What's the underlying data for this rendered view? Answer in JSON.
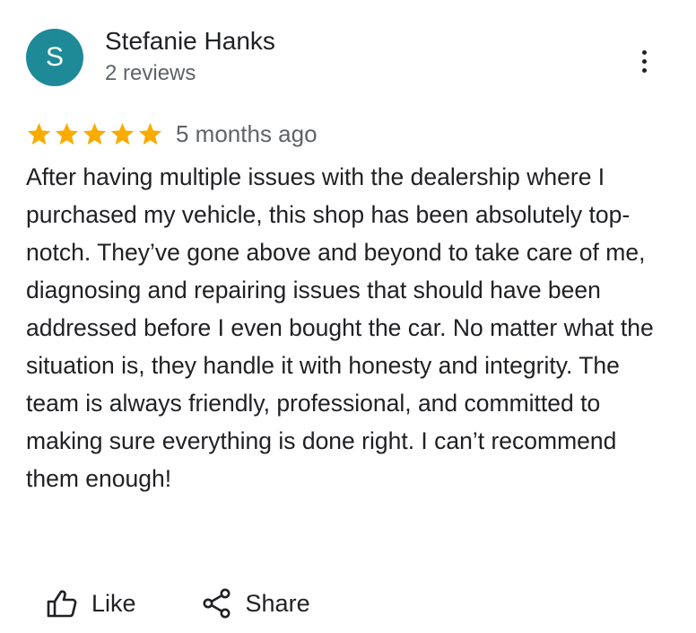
{
  "reviewer": {
    "avatar_initial": "S",
    "avatar_color": "#1e8a98",
    "name": "Stefanie Hanks",
    "review_count": "2 reviews"
  },
  "more_menu": {
    "icon": "more-vert-icon"
  },
  "review": {
    "rating": 5,
    "max_rating": 5,
    "star_color": "#f9ab00",
    "date": "5 months ago",
    "text": "After having multiple issues with the dealership where I purchased my vehicle, this shop has been absolutely top-notch. They’ve gone above and beyond to take care of me, diagnosing and repairing issues that should have been addressed before I even bought the car. No matter what the situation is, they handle it with honesty and integrity. The team is always friendly, professional, and committed to making sure everything is done right. I can’t recommend them enough!"
  },
  "actions": {
    "like_label": "Like",
    "like_icon": "thumb-up-icon",
    "share_label": "Share",
    "share_icon": "share-icon"
  }
}
